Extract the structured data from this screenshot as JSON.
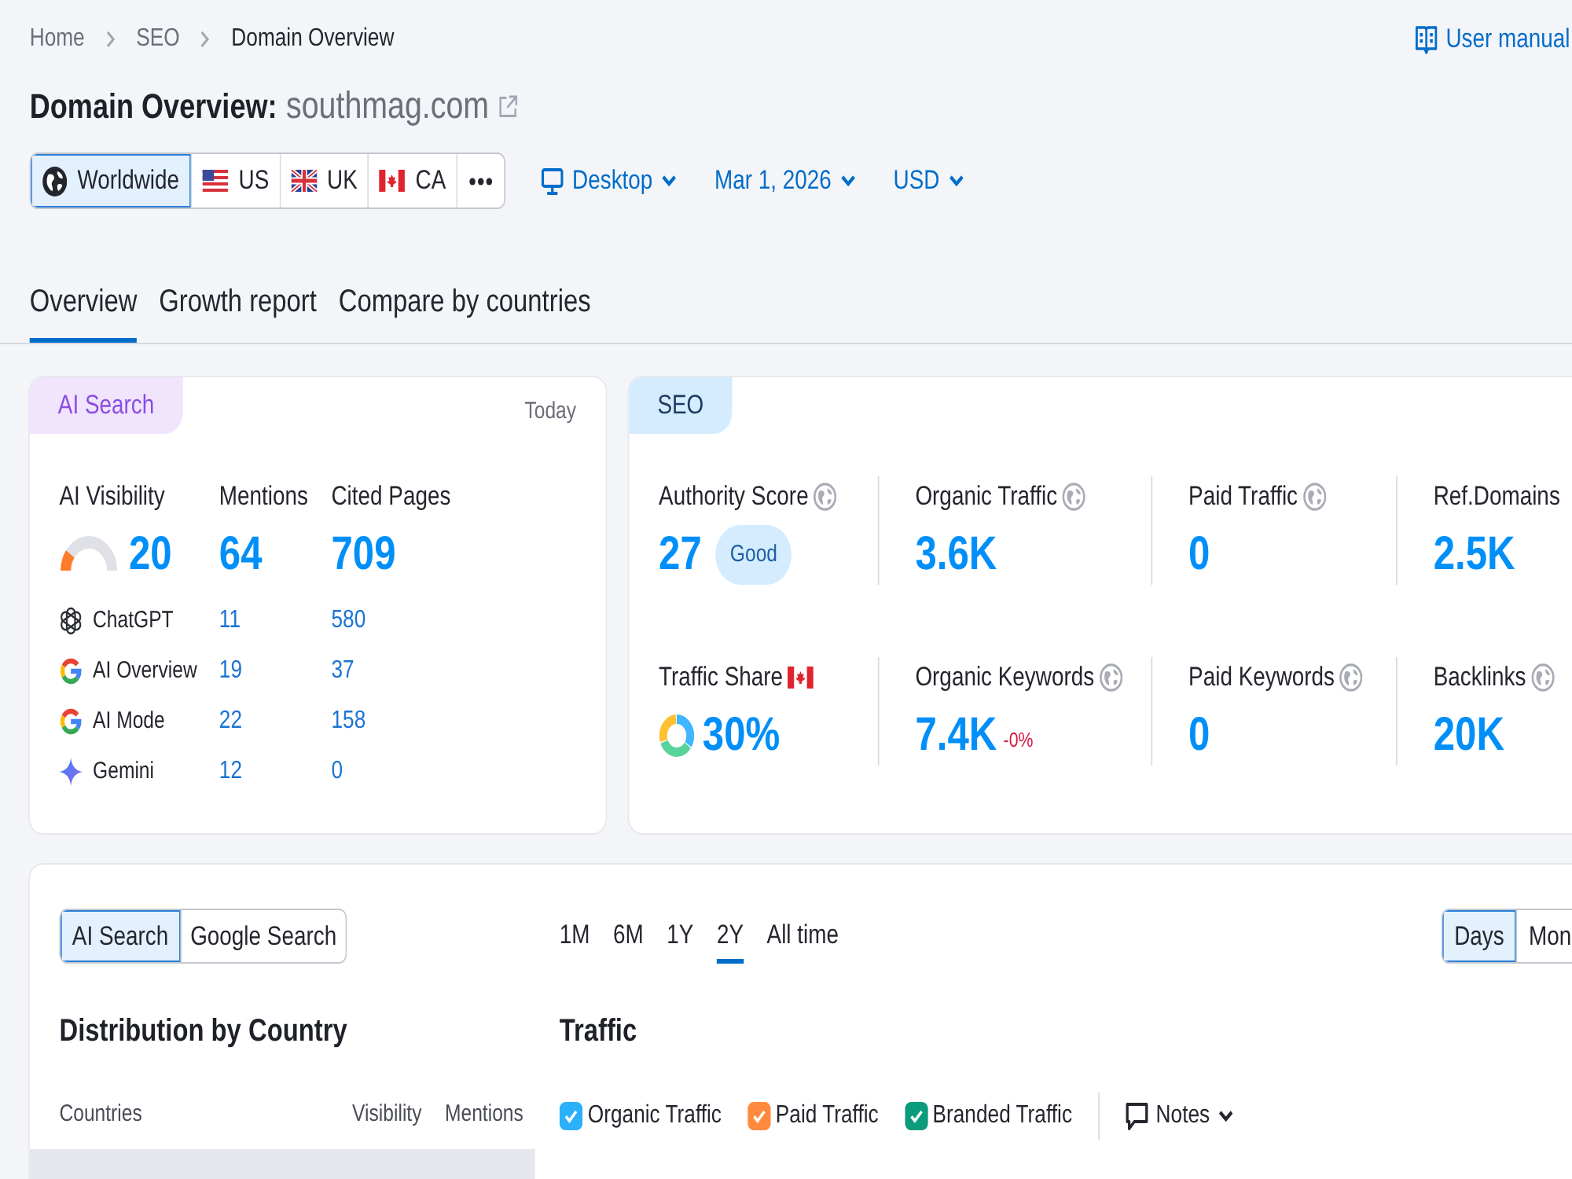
{
  "breadcrumb": [
    {
      "label": "Home",
      "current": false
    },
    {
      "label": "SEO",
      "current": false
    },
    {
      "label": "Domain Overview",
      "current": true
    }
  ],
  "user_manual": {
    "label": "User manual"
  },
  "title": {
    "text": "Domain Overview:",
    "domain": "southmag.com"
  },
  "locations": [
    {
      "kind": "world",
      "label": "Worldwide",
      "selected": true
    },
    {
      "kind": "us",
      "label": "US",
      "selected": false
    },
    {
      "kind": "uk",
      "label": "UK",
      "selected": false
    },
    {
      "kind": "ca",
      "label": "CA",
      "selected": false
    },
    {
      "kind": "more",
      "selected": false
    }
  ],
  "filters": [
    {
      "kind": "device",
      "label": "Desktop"
    },
    {
      "kind": "date",
      "label": "Mar 1, 2026"
    },
    {
      "kind": "currency",
      "label": "USD"
    }
  ],
  "tabs": [
    {
      "label": "Overview",
      "selected": true
    },
    {
      "label": "Growth report",
      "selected": false
    },
    {
      "label": "Compare by countries",
      "selected": false
    }
  ],
  "ai_search": {
    "tab": "AI Search",
    "period": "Today",
    "metrics": [
      {
        "label": "AI Visibility",
        "value": "20",
        "level": 0.2
      },
      {
        "label": "Mentions",
        "value": "64"
      },
      {
        "label": "Cited Pages",
        "value": "709"
      }
    ],
    "sources": [
      {
        "kind": "chatgpt",
        "name": "ChatGPT",
        "mentions": "11",
        "cited_pages": "580"
      },
      {
        "kind": "google",
        "name": "AI Overview",
        "mentions": "19",
        "cited_pages": "37"
      },
      {
        "kind": "google",
        "name": "AI Mode",
        "mentions": "22",
        "cited_pages": "158"
      },
      {
        "kind": "gemini",
        "name": "Gemini",
        "mentions": "12",
        "cited_pages": "0"
      }
    ]
  },
  "seo": {
    "tab": "SEO",
    "metrics": [
      {
        "kind": "metric",
        "label": "Authority Score",
        "value": "27",
        "badge": "Good"
      },
      {
        "kind": "metric",
        "label": "Organic Traffic",
        "value": "3.6K"
      },
      {
        "kind": "metric",
        "label": "Paid Traffic",
        "value": "0"
      },
      {
        "kind": "plain",
        "label": "Ref.Domains",
        "value": "2.5K"
      },
      {
        "kind": "share",
        "label": "Traffic Share",
        "value": "30%"
      },
      {
        "kind": "metric",
        "label": "Organic Keywords",
        "value": "7.4K",
        "change": "-0%"
      },
      {
        "kind": "metric",
        "label": "Paid Keywords",
        "value": "0"
      },
      {
        "kind": "metric",
        "label": "Backlinks",
        "value": "20K"
      }
    ]
  },
  "engine_switch": [
    {
      "label": "AI Search",
      "selected": true
    },
    {
      "label": "Google Search",
      "selected": false
    }
  ],
  "periods": [
    {
      "label": "1M",
      "selected": false
    },
    {
      "label": "6M",
      "selected": false
    },
    {
      "label": "1Y",
      "selected": false
    },
    {
      "label": "2Y",
      "selected": true
    },
    {
      "label": "All time",
      "selected": false
    }
  ],
  "granularity": [
    {
      "label": "Days",
      "selected": true
    },
    {
      "label": "Mon",
      "selected": false
    }
  ],
  "distribution": {
    "title": "Distribution by Country",
    "columns": [
      "Countries",
      "Visibility",
      "Mentions"
    ]
  },
  "traffic": {
    "title": "Traffic",
    "series": [
      {
        "label": "Organic Traffic",
        "checked": true,
        "color": "#2bb0fc"
      },
      {
        "label": "Paid Traffic",
        "checked": true,
        "color": "#ff8a3d"
      },
      {
        "label": "Branded Traffic",
        "checked": true,
        "color": "#0b9c7d"
      }
    ],
    "notes": {
      "label": "Notes"
    }
  }
}
